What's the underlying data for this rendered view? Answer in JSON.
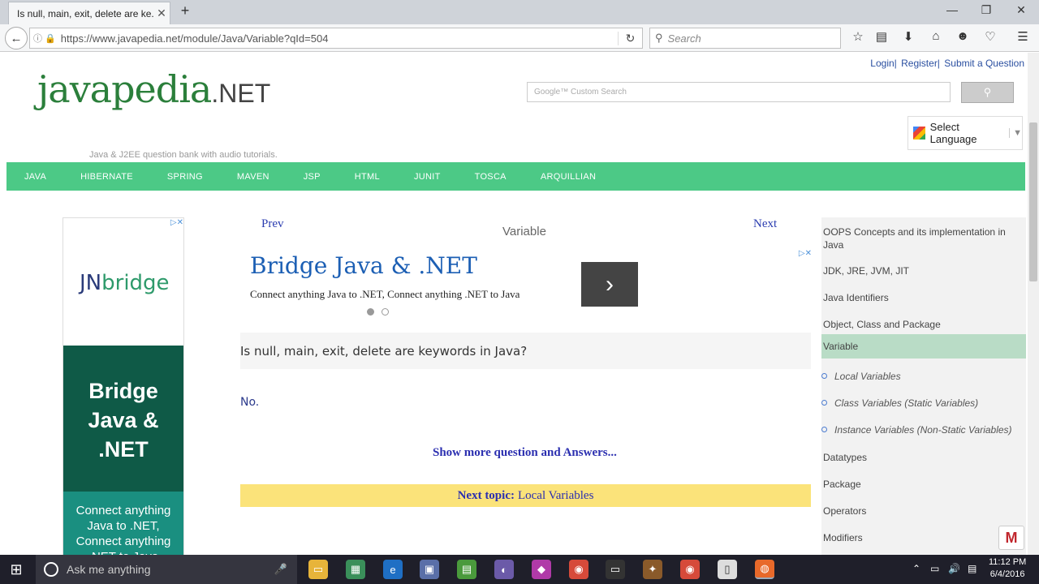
{
  "browser": {
    "tab_title": "Is null, main, exit, delete are ke...",
    "url": "https://www.javapedia.net/module/Java/Variable?qId=504",
    "search_placeholder": "Search"
  },
  "header": {
    "links": [
      "Login|",
      "Register|",
      "Submit a Question"
    ],
    "logo_main": "javapedia",
    "logo_tld": ".NET",
    "tagline": "Java & J2EE question bank with audio tutorials.",
    "google_placeholder": "Google™ Custom Search",
    "language_label": "Select Language"
  },
  "menu": [
    "JAVA",
    "HIBERNATE",
    "SPRING",
    "MAVEN",
    "JSP",
    "HTML",
    "JUNIT",
    "TOSCA",
    "ARQUILLIAN"
  ],
  "left_ad": {
    "logo_a": "JN",
    "logo_b": "bridge",
    "headline": "Bridge Java & .NET",
    "body": "Connect anything Java to .NET, Connect anything .NET to Java"
  },
  "content": {
    "prev": "Prev",
    "next": "Next",
    "title": "Variable",
    "ad_headline": "Bridge Java & .NET",
    "ad_sub": "Connect anything Java to .NET, Connect anything .NET to Java",
    "question": "Is null, main, exit, delete are keywords in Java?",
    "answer": "No.",
    "more": "Show more question and Answers...",
    "next_topic_label": "Next topic:",
    "next_topic": "Local Variables"
  },
  "sidebar": {
    "items": [
      "OOPS Concepts and its implementation in Java",
      "JDK, JRE, JVM, JIT",
      "Java Identifiers",
      "Object, Class and Package",
      "Variable",
      "Datatypes",
      "Package",
      "Operators",
      "Modifiers"
    ],
    "subitems": [
      "Local Variables",
      "Class Variables (Static Variables)",
      "Instance Variables (Non-Static Variables)"
    ]
  },
  "taskbar": {
    "cortana": "Ask me anything",
    "time": "11:12 PM",
    "date": "6/4/2016"
  },
  "colors": {
    "menu_green": "#4cc986",
    "logo_green": "#2b7f3b",
    "link_blue": "#2b3db0",
    "next_topic_bg": "#fbe37a",
    "active_sidebar": "#b9dcc6"
  }
}
